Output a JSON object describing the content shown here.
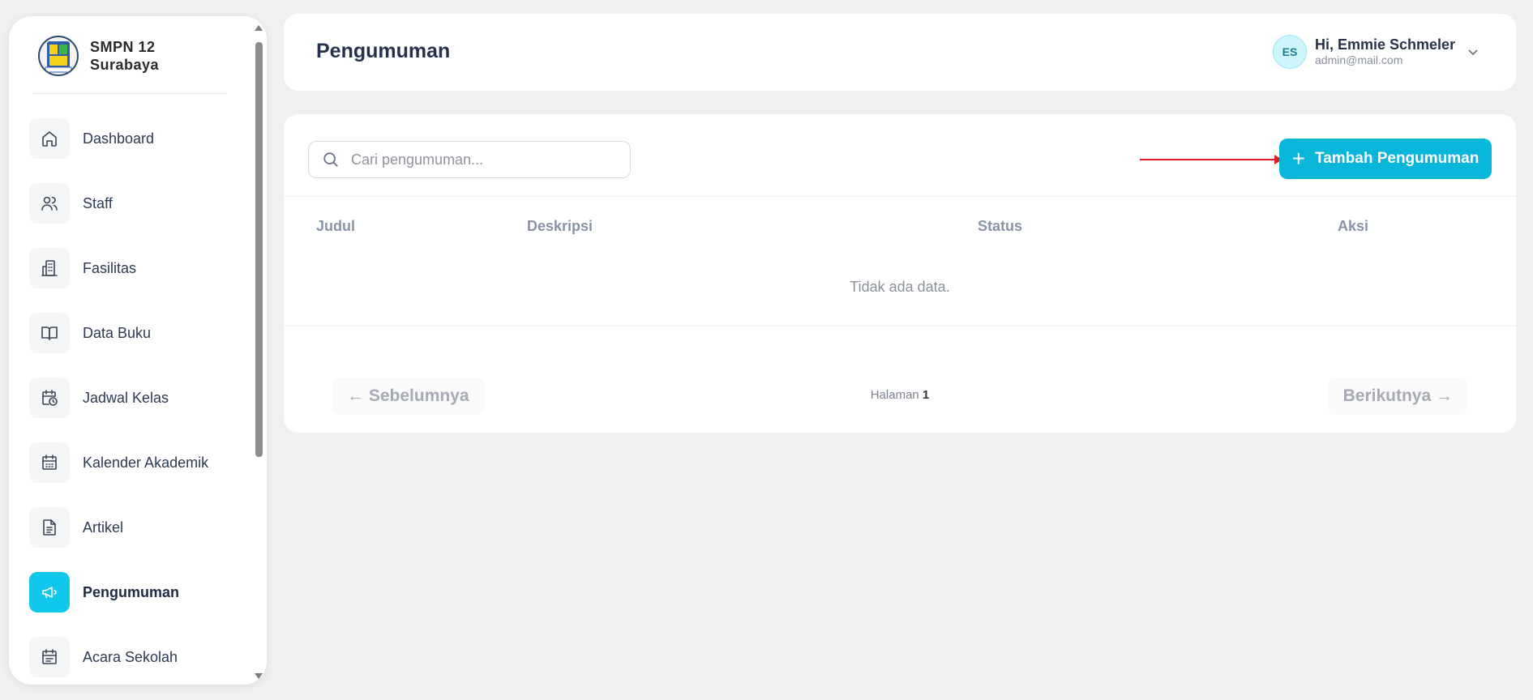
{
  "sidebar": {
    "brand": "SMPN 12 Surabaya",
    "items": [
      {
        "label": "Dashboard",
        "icon": "home-icon"
      },
      {
        "label": "Staff",
        "icon": "users-icon"
      },
      {
        "label": "Fasilitas",
        "icon": "building-icon"
      },
      {
        "label": "Data Buku",
        "icon": "book-open-icon"
      },
      {
        "label": "Jadwal Kelas",
        "icon": "calendar-clock-icon"
      },
      {
        "label": "Kalender Akademik",
        "icon": "calendar-icon"
      },
      {
        "label": "Artikel",
        "icon": "file-text-icon"
      },
      {
        "label": "Pengumuman",
        "icon": "megaphone-icon",
        "active": true
      },
      {
        "label": "Acara Sekolah",
        "icon": "calendar-list-icon"
      }
    ]
  },
  "header": {
    "title": "Pengumuman",
    "user": {
      "initials": "ES",
      "greeting": "Hi, Emmie Schmeler",
      "email": "admin@mail.com"
    }
  },
  "main": {
    "search_placeholder": "Cari pengumuman...",
    "add_button": "Tambah Pengumuman",
    "columns": [
      "Judul",
      "Deskripsi",
      "Status",
      "Aksi"
    ],
    "empty_text": "Tidak ada data.",
    "pagination": {
      "prev": "← Sebelumnya",
      "next": "Berikutnya →",
      "label": "Halaman",
      "page": "1"
    }
  },
  "colors": {
    "accent": "#08b6d9",
    "active_nav": "#12c7ec",
    "annotation_arrow": "#e02020"
  }
}
